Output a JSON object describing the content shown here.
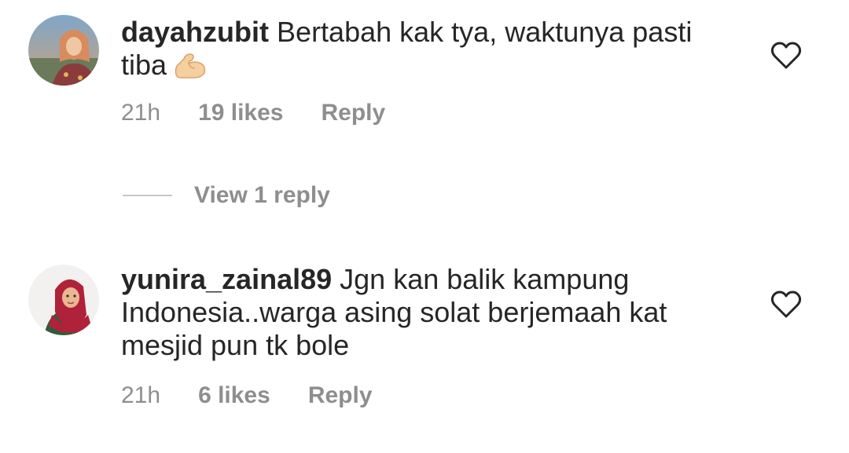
{
  "comments": [
    {
      "username": "dayahzubit",
      "text": "Bertabah kak tya, waktunya pasti tiba",
      "emoji": "flexed-biceps",
      "time": "21h",
      "likes": "19 likes",
      "reply_label": "Reply",
      "icon": "heart-outline-icon"
    },
    {
      "username": "yunira_zainal89",
      "text": "Jgn kan balik kampung Indonesia..warga asing solat berjemaah kat mesjid pun tk bole",
      "time": "21h",
      "likes": "6 likes",
      "reply_label": "Reply",
      "icon": "heart-outline-icon"
    }
  ],
  "view_replies": {
    "label": "View 1 reply"
  },
  "colors": {
    "text": "#262626",
    "secondary": "#8e8e8e",
    "divider": "#c7c7c7"
  }
}
